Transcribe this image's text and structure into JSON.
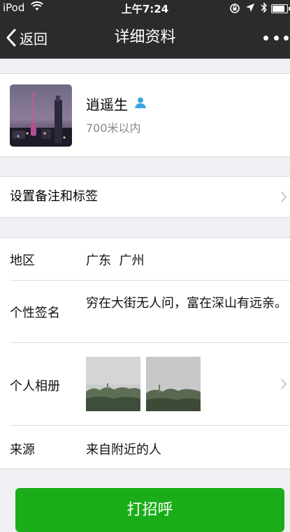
{
  "status_bar": {
    "carrier": "iPod",
    "time": "上午7:24",
    "battery_level": 0.85
  },
  "nav": {
    "back_label": "返回",
    "title": "详细资料",
    "more_icon": "more-dots-icon"
  },
  "profile": {
    "name": "逍遥生",
    "distance": "700米以内",
    "gender_icon": "person-icon"
  },
  "remark": {
    "label": "设置备注和标签"
  },
  "info": {
    "region_label": "地区",
    "region_value": "广东  广州",
    "signature_label": "个性签名",
    "signature_value": "穷在大街无人问，富在深山有远亲。",
    "album_label": "个人相册",
    "source_label": "来源",
    "source_value": "来自附近的人"
  },
  "actions": {
    "greet_label": "打招呼"
  },
  "colors": {
    "bar": "#2b2b2d",
    "button": "#1aad19",
    "background": "#efeff4"
  }
}
